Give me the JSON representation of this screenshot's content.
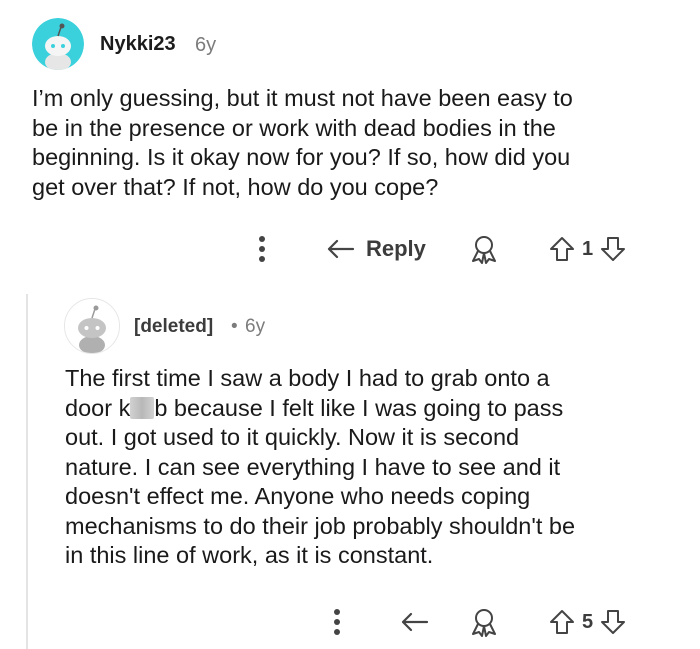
{
  "comments": [
    {
      "username": "Nykki23",
      "age": "6y",
      "body": "I’m only guessing, but it must not have been easy to\nbe in the presence or work with dead bodies in the\nbeginning. Is it okay now for you? If so, how did you\nget over that? If not, how do you cope?",
      "actions": {
        "reply_label": "Reply",
        "vote_count": "1"
      },
      "avatar_color": "#3bd1dc"
    },
    {
      "username": "[deleted]",
      "separator": "•",
      "age": "6y",
      "body_before_blur": "The first time I saw a body I had to grab onto a\ndoor k",
      "body_after_blur": "b because I felt like I was going to pass\nout. I got used to it quickly. Now it is second\nnature. I can see everything I have to see and it\ndoesn't effect me. Anyone who needs coping\nmechanisms to do their job probably shouldn't be\nin this line of work, as it is constant.",
      "actions": {
        "vote_count": "5"
      },
      "avatar_color": "#ffffff"
    }
  ],
  "icons": {
    "more": "more-vertical-icon",
    "reply": "reply-arrow-icon",
    "award": "award-icon",
    "upvote": "upvote-arrow-icon",
    "downvote": "downvote-arrow-icon"
  }
}
